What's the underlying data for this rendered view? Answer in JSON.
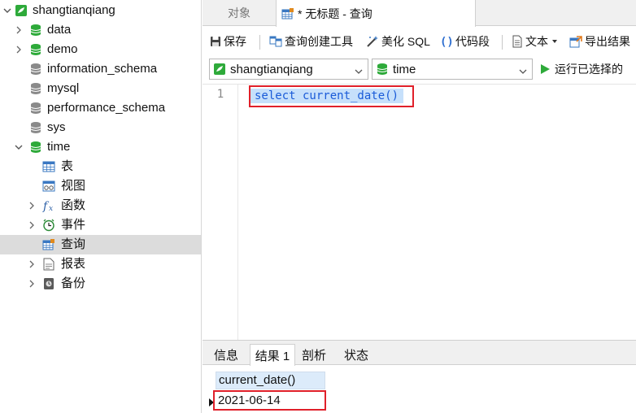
{
  "sidebar": {
    "connection": "shangtianqiang",
    "databases": [
      "data",
      "demo",
      "information_schema",
      "mysql",
      "performance_schema",
      "sys",
      "time"
    ],
    "time_children": [
      "表",
      "视图",
      "函数",
      "事件",
      "查询",
      "报表",
      "备份"
    ]
  },
  "tabs": {
    "objects": "对象",
    "query": "* 无标题 - 查询"
  },
  "toolbar": {
    "save": "保存",
    "query_builder": "查询创建工具",
    "beautify": "美化 SQL",
    "snippet": "代码段",
    "text": "文本",
    "export": "导出结果"
  },
  "selectors": {
    "connection": "shangtianqiang",
    "database": "time",
    "run": "运行已选择的"
  },
  "editor": {
    "line_number": "1",
    "code": "select current_date()"
  },
  "results": {
    "tabs": [
      "信息",
      "结果 1",
      "剖析",
      "状态"
    ],
    "column": "current_date()",
    "value": "2021-06-14"
  },
  "colors": {
    "db_green": "#2eaa3a",
    "highlight_red": "#e0202a",
    "selection_blue": "#c6e0fb",
    "sql_blue": "#1a5bd8"
  }
}
